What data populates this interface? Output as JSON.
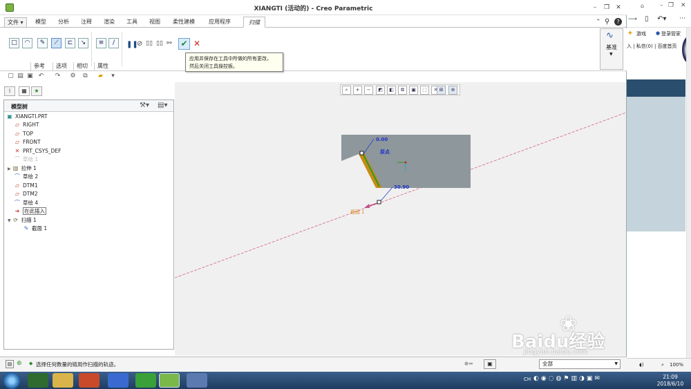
{
  "window": {
    "title": "XIANGTI (活动的) - Creo Parametric"
  },
  "tabs": {
    "file": "文件",
    "items": [
      "模型",
      "分析",
      "注释",
      "渲染",
      "工具",
      "视图",
      "柔性建模",
      "应用程序"
    ],
    "active": "扫描"
  },
  "ribbon": {
    "subtabs": [
      "参考",
      "选项",
      "相切",
      "属性"
    ],
    "datum_label": "基准",
    "tooltip_line1": "应用并保存在工具中所做的所有更改，",
    "tooltip_line2": "然后关闭工具操控板。"
  },
  "tree": {
    "header": "模型树",
    "nodes": [
      {
        "label": "XIANGTI.PRT",
        "icon": "part-icon"
      },
      {
        "label": "RIGHT",
        "icon": "plane-icon"
      },
      {
        "label": "TOP",
        "icon": "plane-icon"
      },
      {
        "label": "FRONT",
        "icon": "plane-icon"
      },
      {
        "label": "PRT_CSYS_DEF",
        "icon": "csys-icon"
      },
      {
        "label": "草绘 1",
        "icon": "sketch-icon"
      },
      {
        "label": "拉伸 1",
        "icon": "extrude-icon"
      },
      {
        "label": "草绘 2",
        "icon": "sketch-icon"
      },
      {
        "label": "DTM1",
        "icon": "plane-icon"
      },
      {
        "label": "DTM2",
        "icon": "plane-icon"
      },
      {
        "label": "草绘 4",
        "icon": "sketch-icon"
      },
      {
        "label": "在此插入",
        "icon": "insert-arrow-icon"
      },
      {
        "label": "扫描 1",
        "icon": "sweep-icon"
      },
      {
        "label": "截面 1",
        "icon": "section-icon"
      }
    ]
  },
  "graphics": {
    "dim_start": "0.00",
    "origin_label": "原点",
    "dim_end": "30.90",
    "section_label": "截面 1"
  },
  "status": {
    "message": "选择任何数量的链用作扫描的轨迹。",
    "filter": "全部"
  },
  "browser": {
    "games": "游戏",
    "login": "登录管家",
    "tabs_text": "入 | 私信(0) | 百度首页",
    "zoom": "100%"
  },
  "taskbar": {
    "time": "21:09",
    "date": "2018/6/10",
    "lang": "CH"
  },
  "watermark": {
    "text": "Baidu经验",
    "sub": "jingyan.baidu.com"
  }
}
